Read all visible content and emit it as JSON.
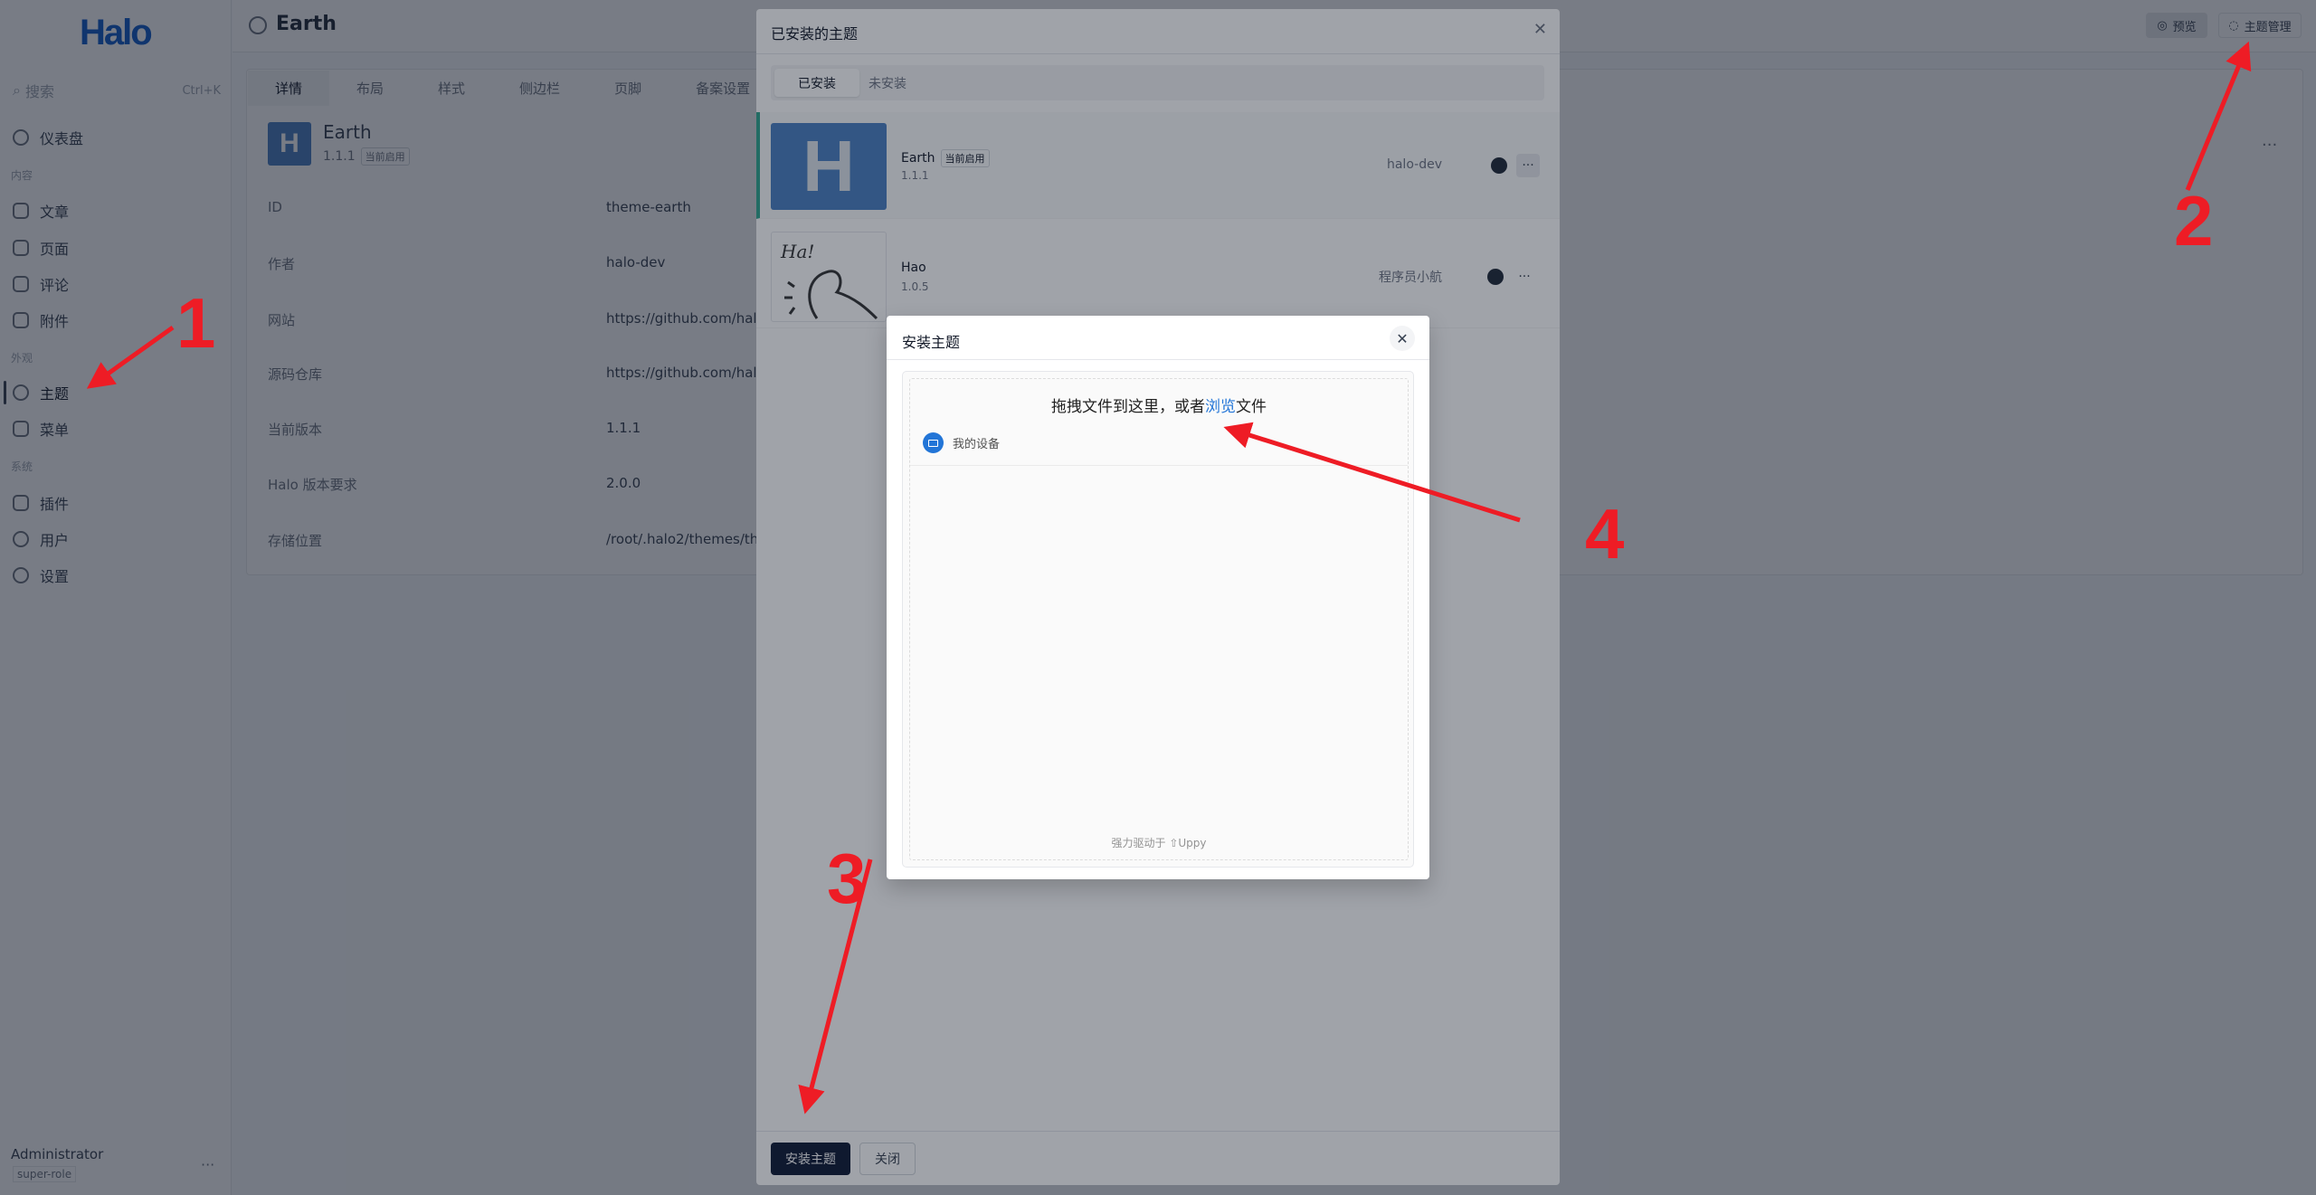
{
  "sidebar": {
    "logo": "Halo",
    "search_placeholder": "搜索",
    "search_shortcut": "Ctrl+K",
    "items": [
      {
        "label": "仪表盘"
      },
      {
        "group": "内容"
      },
      {
        "label": "文章"
      },
      {
        "label": "页面"
      },
      {
        "label": "评论"
      },
      {
        "label": "附件"
      },
      {
        "group": "外观"
      },
      {
        "label": "主题",
        "active": true
      },
      {
        "label": "菜单"
      },
      {
        "group": "系统"
      },
      {
        "label": "插件"
      },
      {
        "label": "用户"
      },
      {
        "label": "设置"
      }
    ],
    "user": {
      "name": "Administrator",
      "role": "super-role"
    }
  },
  "header": {
    "title": "Earth",
    "preview": "预览",
    "manage": "主题管理"
  },
  "theme_detail": {
    "tabs": [
      "详情",
      "布局",
      "样式",
      "侧边栏",
      "页脚",
      "备案设置"
    ],
    "name": "Earth",
    "version": "1.1.1",
    "badge": "当前启用",
    "rows": [
      {
        "label": "ID",
        "value": "theme-earth"
      },
      {
        "label": "作者",
        "value": "halo-dev"
      },
      {
        "label": "网站",
        "value": "https://github.com/halo-"
      },
      {
        "label": "源码仓库",
        "value": "https://github.com/halo-"
      },
      {
        "label": "当前版本",
        "value": "1.1.1"
      },
      {
        "label": "Halo 版本要求",
        "value": "2.0.0"
      },
      {
        "label": "存储位置",
        "value": "/root/.halo2/themes/the"
      }
    ]
  },
  "installed_modal": {
    "title": "已安装的主题",
    "tabs": [
      "已安装",
      "未安装"
    ],
    "themes": [
      {
        "name": "Earth",
        "badge": "当前启用",
        "version": "1.1.1",
        "author": "halo-dev"
      },
      {
        "name": "Hao",
        "version": "1.0.5",
        "author": "程序员小航",
        "thumb_text": "Ha!"
      }
    ],
    "install_button": "安装主题",
    "close_button": "关闭"
  },
  "install_modal": {
    "title": "安装主题",
    "drop_prefix": "拖拽文件到这里，或者",
    "browse": "浏览",
    "drop_suffix": "文件",
    "source": "我的设备",
    "powered": "强力驱动于 ⇧Uppy"
  },
  "annotations": [
    "1",
    "2",
    "3",
    "4"
  ],
  "colors": {
    "accent": "#2275d7",
    "annotation": "#ee1c25",
    "active_border": "#2fa38d"
  }
}
